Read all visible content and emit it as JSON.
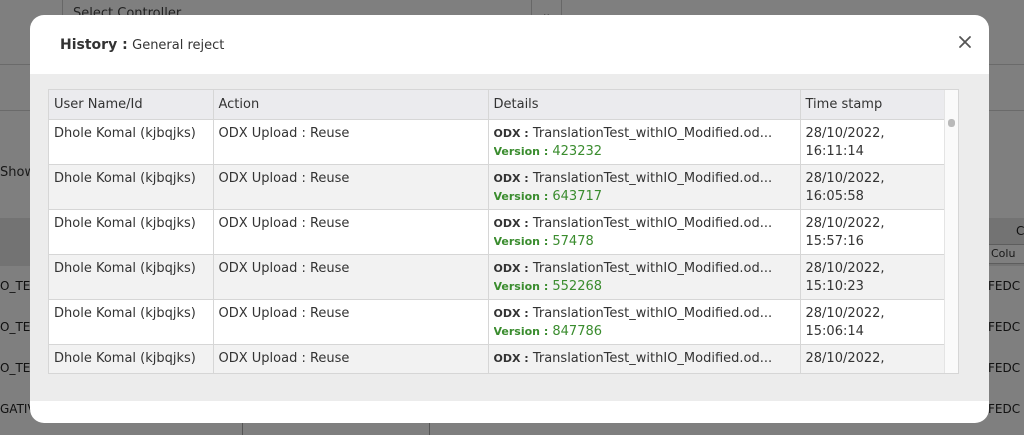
{
  "background": {
    "select_placeholder": "Select Controller",
    "show_text": "Show",
    "left_cells": [
      "O_TEX",
      "O_TEX",
      "O_TEX",
      "GATIV"
    ],
    "right_cells": [
      "FEDC",
      "FEDC",
      "FEDC",
      "FEDC"
    ],
    "column_button": "Colu",
    "column_header_fragment": "C"
  },
  "modal": {
    "title_label": "History :",
    "title_value": "General reject",
    "close_icon": "close-icon"
  },
  "table": {
    "columns": [
      "User Name/Id",
      "Action",
      "Details",
      "Time stamp"
    ],
    "odx_label": "ODX :",
    "version_label": "Version :",
    "rows": [
      {
        "user": "Dhole Komal (kjbqjks)",
        "action": "ODX Upload : Reuse",
        "file": "TranslationTest_withIO_Modified.od...",
        "version": "423232",
        "date": "28/10/2022,",
        "time": "16:11:14"
      },
      {
        "user": "Dhole Komal (kjbqjks)",
        "action": "ODX Upload : Reuse",
        "file": "TranslationTest_withIO_Modified.od...",
        "version": "643717",
        "date": "28/10/2022,",
        "time": "16:05:58"
      },
      {
        "user": "Dhole Komal (kjbqjks)",
        "action": "ODX Upload : Reuse",
        "file": "TranslationTest_withIO_Modified.od...",
        "version": "57478",
        "date": "28/10/2022,",
        "time": "15:57:16"
      },
      {
        "user": "Dhole Komal (kjbqjks)",
        "action": "ODX Upload : Reuse",
        "file": "TranslationTest_withIO_Modified.od...",
        "version": "552268",
        "date": "28/10/2022,",
        "time": "15:10:23"
      },
      {
        "user": "Dhole Komal (kjbqjks)",
        "action": "ODX Upload : Reuse",
        "file": "TranslationTest_withIO_Modified.od...",
        "version": "847786",
        "date": "28/10/2022,",
        "time": "15:06:14"
      },
      {
        "user": "Dhole Komal (kjbqjks)",
        "action": "ODX Upload : Reuse",
        "file": "TranslationTest_withIO_Modified.od...",
        "version": "",
        "date": "28/10/2022,",
        "time": ""
      }
    ]
  },
  "colors": {
    "version_green": "#3a8c2e",
    "header_bg": "#ebebee",
    "row_alt_bg": "#f2f2f2"
  }
}
